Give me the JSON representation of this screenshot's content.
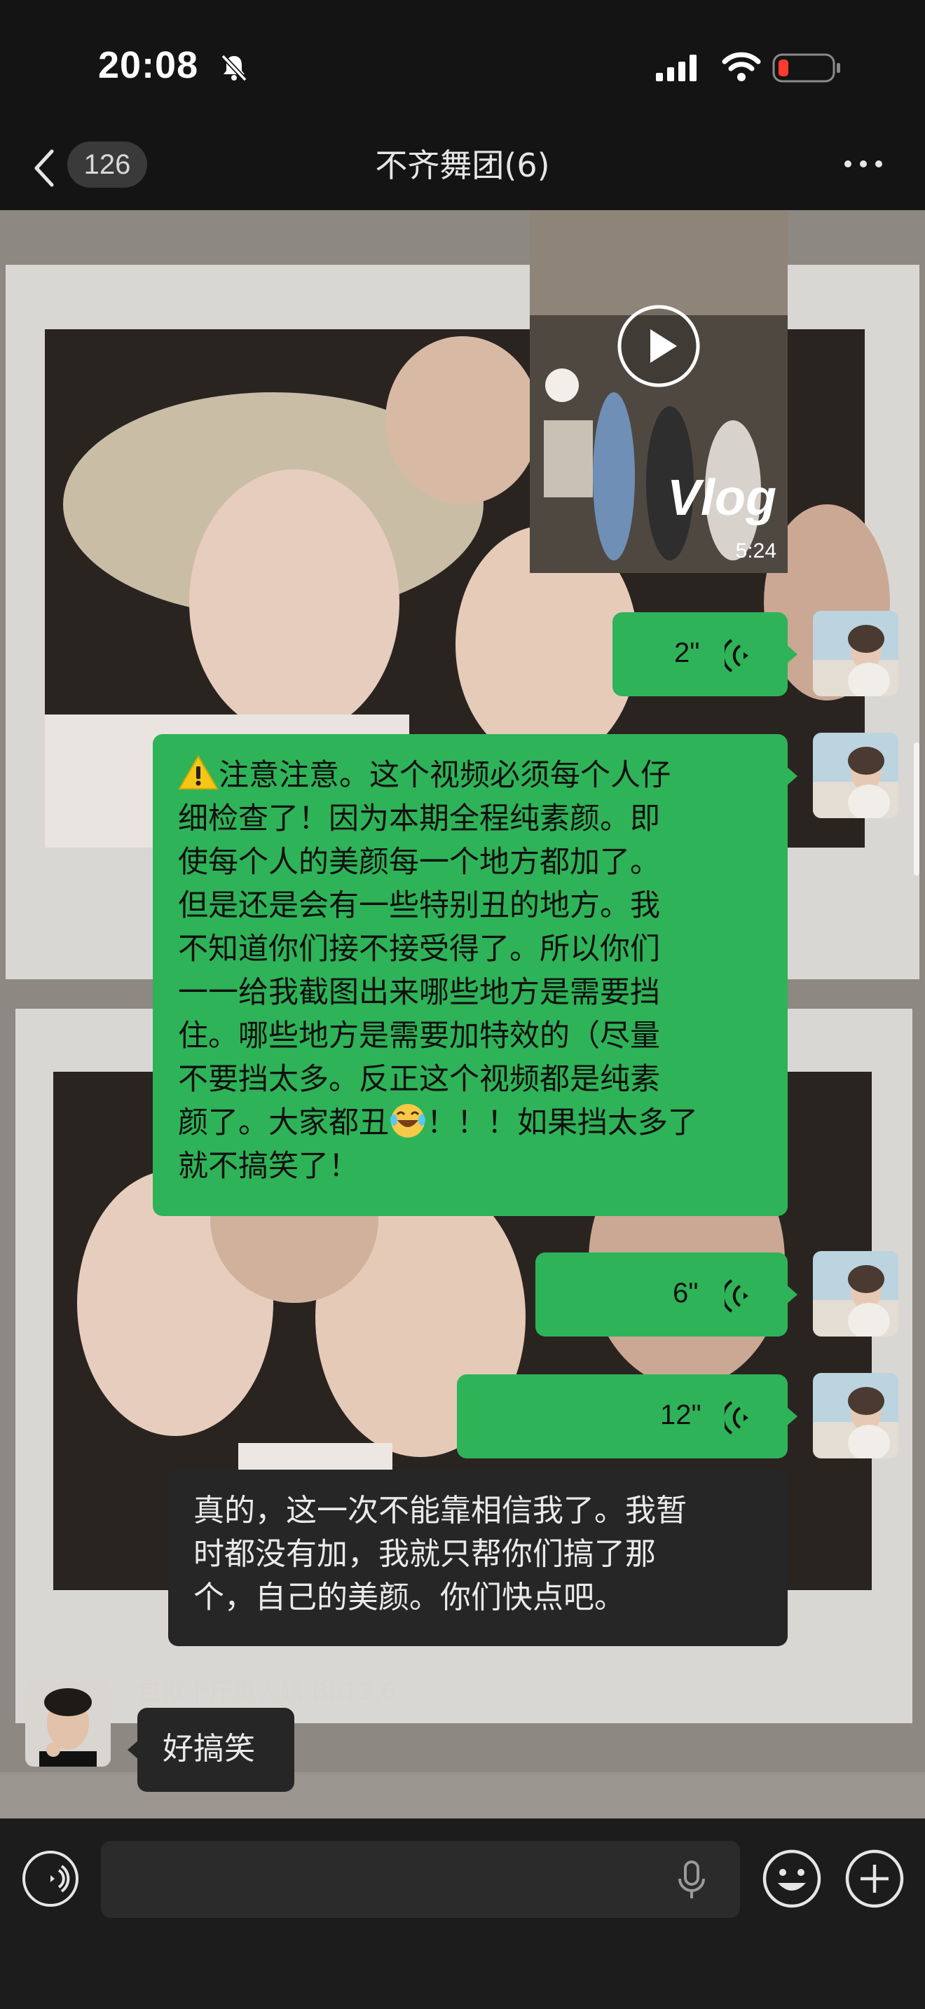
{
  "status_bar": {
    "time": "20:08",
    "icons": [
      "bell-slash-icon",
      "cellular-signal-icon",
      "wifi-icon",
      "battery-low-icon"
    ]
  },
  "nav": {
    "back_icon": "chevron-left-icon",
    "unread_count": "126",
    "title": "不齐舞团(6)",
    "more_icon": "more-dots-icon"
  },
  "messages": [
    {
      "type": "video",
      "direction": "outgoing",
      "overlay_text": "Vlog",
      "duration": "5:24",
      "icon": "play-icon"
    },
    {
      "type": "voice",
      "direction": "outgoing",
      "length": "2\"",
      "icon": "voice-wave-icon"
    },
    {
      "type": "text",
      "direction": "outgoing",
      "lead_icon": "warning-icon",
      "text_part1": "注意注意。这个视频必须每个人仔\n细检查了！因为本期全程纯素颜。即\n使每个人的美颜每一个地方都加了。\n但是还是会有一些特别丑的地方。我\n不知道你们接不接受得了。所以你们\n一一给我截图出来哪些地方是需要挡\n住。哪些地方是需要加特效的（尽量\n不要挡太多。反正这个视频都是纯素\n颜了。大家都丑",
      "inline_icon": "laughing-tears-icon",
      "text_part2": "！！！如果挡太多了\n就不搞笑了！"
    },
    {
      "type": "voice",
      "direction": "outgoing",
      "length": "6\"",
      "icon": "voice-wave-icon"
    },
    {
      "type": "voice",
      "direction": "outgoing",
      "length": "12\"",
      "icon": "voice-wave-icon"
    },
    {
      "type": "text",
      "direction": "incoming",
      "text": "真的，这一次不能靠相信我了。我暂\n时都没有加，我就只帮你们搞了那\n个，自己的美颜。你们快点吧。"
    },
    {
      "type": "text",
      "direction": "incoming",
      "sender": "包袱十斤重大姨 Bb12.6",
      "text": "好搞笑"
    }
  ],
  "input_bar": {
    "voice_toggle_icon": "voice-mode-icon",
    "placeholder": "",
    "mic_icon": "microphone-icon",
    "emoji_icon": "emoji-icon",
    "add_icon": "plus-circle-icon"
  },
  "colors": {
    "outgoing_bubble": "#2fb358",
    "incoming_bubble": "#262626",
    "bar_background": "#141414"
  }
}
